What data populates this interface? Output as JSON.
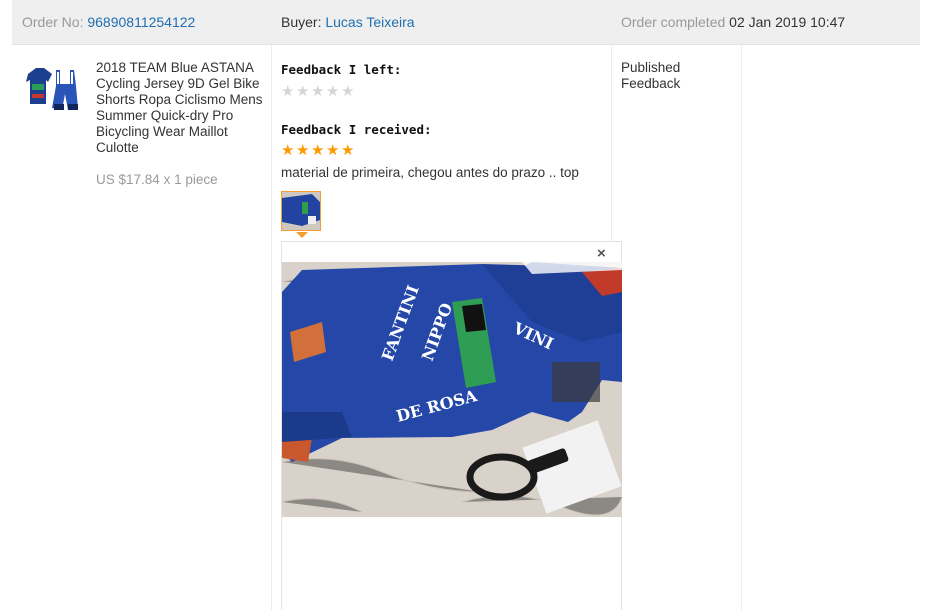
{
  "order": {
    "order_no_label": "Order No:",
    "order_no": "96890811254122",
    "buyer_label": "Buyer:",
    "buyer_name": "Lucas Teixeira",
    "completed_label": "Order completed",
    "completed_date": "02 Jan 2019 10:47"
  },
  "product": {
    "title": "2018 TEAM Blue ASTANA Cycling Jersey 9D Gel Bike Shorts Ropa Ciclismo Mens Summer Quick-dry Pro Bicycling Wear Maillot Culotte",
    "price": "US $17.84",
    "quantity": "x 1 piece",
    "thumb_icon": "cycling-kit-image"
  },
  "feedback": {
    "left_label": "Feedback I left:",
    "left_stars": 0,
    "received_label": "Feedback I received:",
    "received_stars": 5,
    "comment": "material de primeira, chegou antes do prazo .. top",
    "close_symbol": "×",
    "star_color": "#ff9900",
    "empty_star_color": "#d5d5d5"
  },
  "status": {
    "line1": "Published",
    "line2": "Feedback"
  }
}
